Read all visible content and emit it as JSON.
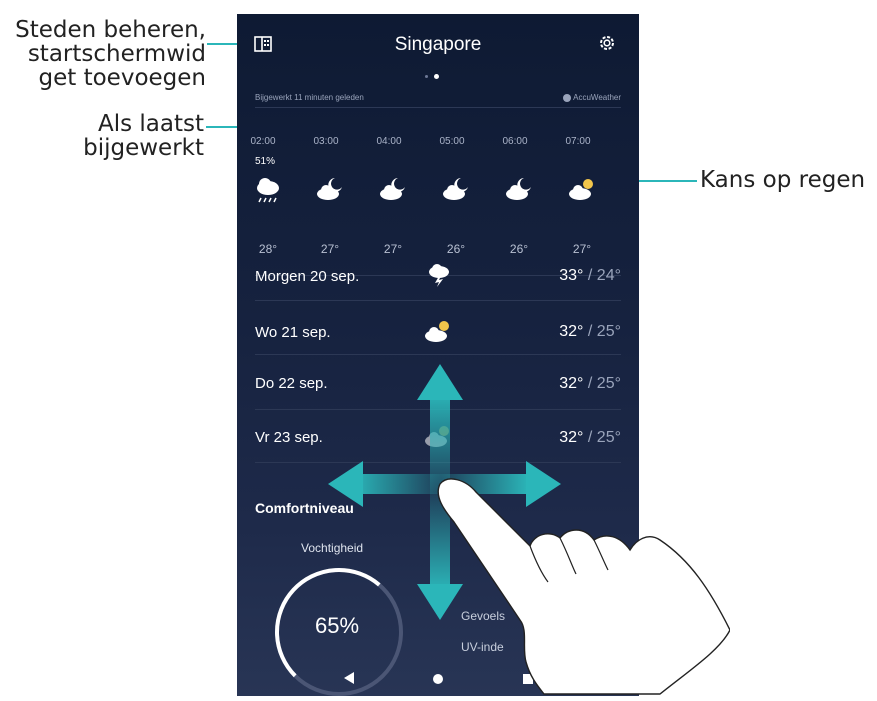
{
  "callouts": {
    "manage": "Steden beheren,\nstartschermwid\nget toevoegen",
    "updated": "Als laatst\nbijgewerkt",
    "rain": "Kans op regen"
  },
  "header": {
    "city": "Singapore",
    "updated_text": "Bijgewerkt 11 minuten geleden",
    "provider": "AccuWeather"
  },
  "hourly": {
    "times": [
      "02:00",
      "03:00",
      "04:00",
      "05:00",
      "06:00",
      "07:00"
    ],
    "rain_chance": "51%",
    "temps": [
      "28°",
      "27°",
      "27°",
      "26°",
      "26°",
      "27°"
    ],
    "icons": [
      "rain-icon",
      "moon-cloud-icon",
      "moon-cloud-icon",
      "moon-cloud-icon",
      "moon-cloud-icon",
      "sun-cloud-icon"
    ]
  },
  "daily": [
    {
      "day": "Morgen 20 sep.",
      "high": "33°",
      "low": "/ 24°",
      "icon": "thunderstorm-icon"
    },
    {
      "day": "Wo 21 sep.",
      "high": "32°",
      "low": "/ 25°",
      "icon": "sun-cloud-icon"
    },
    {
      "day": "Do 22 sep.",
      "high": "32°",
      "low": "/ 25°",
      "icon": "sun-cloud-icon"
    },
    {
      "day": "Vr 23 sep.",
      "high": "32°",
      "low": "/ 25°",
      "icon": "sun-cloud-icon"
    }
  ],
  "comfort": {
    "title": "Comfortniveau",
    "humidity_label": "Vochtigheid",
    "humidity_value": "65%",
    "humidity_fraction": 0.65,
    "feels_label": "Gevoels",
    "uv_label": "UV-inde"
  },
  "colors": {
    "accent": "#2bb6b9"
  }
}
